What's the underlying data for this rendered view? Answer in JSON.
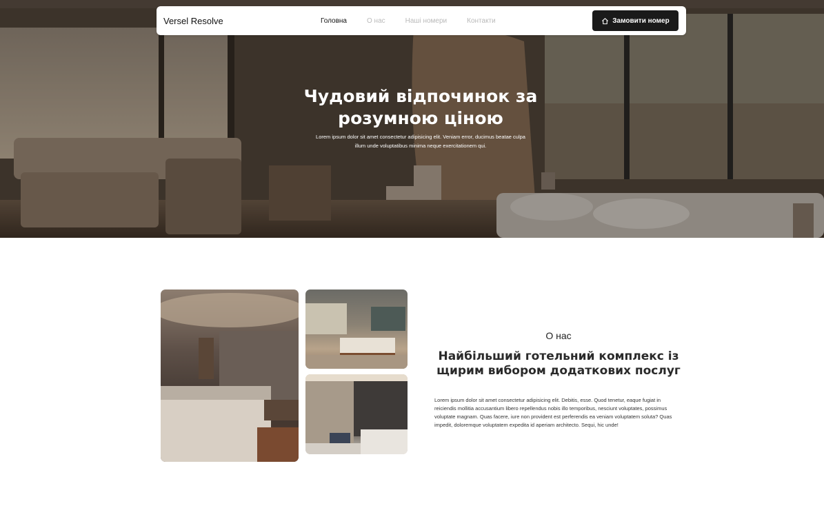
{
  "nav": {
    "brand": "Versel Resolve",
    "links": [
      {
        "label": "Головна",
        "active": true
      },
      {
        "label": "О нас",
        "active": false
      },
      {
        "label": "Наші номери",
        "active": false
      },
      {
        "label": "Контакти",
        "active": false
      }
    ],
    "book_label": "Замовити номер",
    "book_icon": "home-icon"
  },
  "hero": {
    "title_line1": "Чудовий відпочинок за",
    "title_line2": "розумною ціною",
    "subtitle_line1": "Lorem ipsum dolor sit amet consectetur adipisicing elit. Veniam error, ducimus beatae culpa",
    "subtitle_line2": "illum unde voluptatibus minima neque exercitationem qui."
  },
  "about": {
    "label": "О нас",
    "title_line1": "Найбільший готельний комплекс із",
    "title_line2": "щирим вибором додаткових послуг",
    "text": "Lorem ipsum dolor sit amet consectetur adipisicing elit. Debitis, esse. Quod tenetur, eaque fugiat in reiciendis mollitia accusantium libero repellendus nobis illo temporibus, nesciunt voluptates, possimus voluptate magnam. Quas facere, iure non provident est perferendis ea veniam voluptatem soluta? Quas impedit, doloremque voluptatem expedita id aperiam architecto. Sequi, hic unde!"
  },
  "colors": {
    "nav_bg": "#ffffff",
    "button_bg": "#1a1a1a",
    "inactive_link": "#b9b9b9"
  }
}
